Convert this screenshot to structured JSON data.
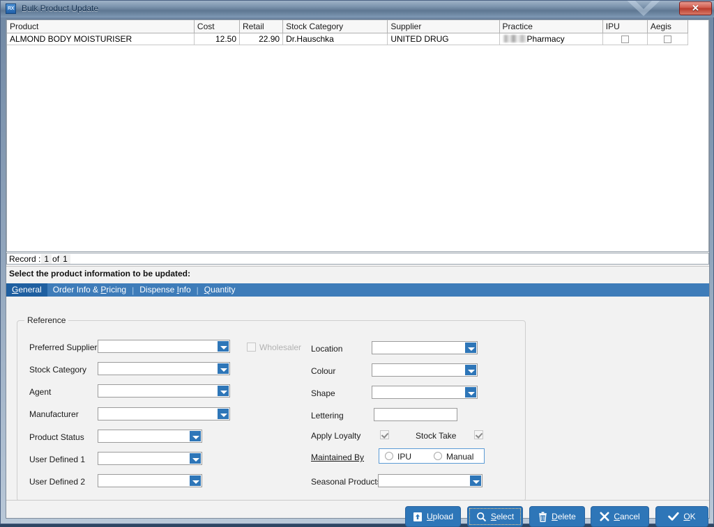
{
  "window": {
    "title": "Bulk Product Update",
    "app_icon": "rx-icon",
    "icon_text": "RX",
    "close_label": "✕",
    "accent_color": "#2e76b8",
    "titlebar_color": "#7d95ae",
    "close_color": "#c04a3a"
  },
  "grid": {
    "columns": [
      "Product",
      "Cost",
      "Retail",
      "Stock Category",
      "Supplier",
      "Practice",
      "IPU",
      "Aegis"
    ],
    "rows": [
      {
        "product": "ALMOND BODY MOISTURISER",
        "cost": "12.50",
        "retail": "22.90",
        "stock_category": "Dr.Hauschka",
        "supplier": "UNITED DRUG",
        "practice": "Pharmacy",
        "practice_redacted": true,
        "ipu": false,
        "aegis": false
      }
    ]
  },
  "record_bar": {
    "label": "Record :",
    "current": "1",
    "of": "of",
    "total": "1"
  },
  "instruction": "Select the product information to be updated:",
  "tabs": [
    {
      "label": "General",
      "accel": "G",
      "active": true
    },
    {
      "label": "Order Info & Pricing",
      "accel": "P",
      "active": false
    },
    {
      "label": "Dispense Info",
      "accel": "I",
      "active": false
    },
    {
      "label": "Quantity",
      "accel": "Q",
      "active": false
    }
  ],
  "form": {
    "group_title": "Reference",
    "left_fields": [
      {
        "label": "Preferred Supplier",
        "value": "",
        "type": "combo"
      },
      {
        "label": "Stock Category",
        "value": "",
        "type": "combo"
      },
      {
        "label": "Agent",
        "value": "",
        "type": "combo"
      },
      {
        "label": "Manufacturer",
        "value": "",
        "type": "combo"
      },
      {
        "label": "Product Status",
        "value": "",
        "type": "combo"
      },
      {
        "label": "User Defined 1",
        "value": "",
        "type": "combo"
      },
      {
        "label": "User Defined 2",
        "value": "",
        "type": "combo"
      }
    ],
    "wholesaler": {
      "label": "Wholesaler",
      "checked": false,
      "disabled": true
    },
    "right_fields": [
      {
        "label": "Location",
        "value": "",
        "type": "combo"
      },
      {
        "label": "Colour",
        "value": "",
        "type": "combo"
      },
      {
        "label": "Shape",
        "value": "",
        "type": "combo"
      },
      {
        "label": "Lettering",
        "value": "",
        "type": "text"
      }
    ],
    "apply_loyalty": {
      "label": "Apply Loyalty",
      "checked": true,
      "disabled": true
    },
    "stock_take": {
      "label": "Stock Take",
      "checked": true,
      "disabled": true
    },
    "maintained_by": {
      "label": "Maintained By",
      "options": [
        "IPU",
        "Manual"
      ],
      "selected": ""
    },
    "seasonal_products": {
      "label": "Seasonal Products",
      "value": "",
      "type": "combo"
    }
  },
  "buttons": [
    {
      "label": "Upload",
      "accel": "U",
      "icon": "upload-icon",
      "focused": false
    },
    {
      "label": "Select",
      "accel": "S",
      "icon": "magnifier-icon",
      "focused": true
    },
    {
      "label": "Delete",
      "accel": "D",
      "icon": "trash-icon",
      "focused": false
    },
    {
      "label": "Cancel",
      "accel": "C",
      "icon": "cross-icon",
      "focused": false
    },
    {
      "label": "OK",
      "accel": "O",
      "icon": "check-icon",
      "focused": false
    }
  ]
}
